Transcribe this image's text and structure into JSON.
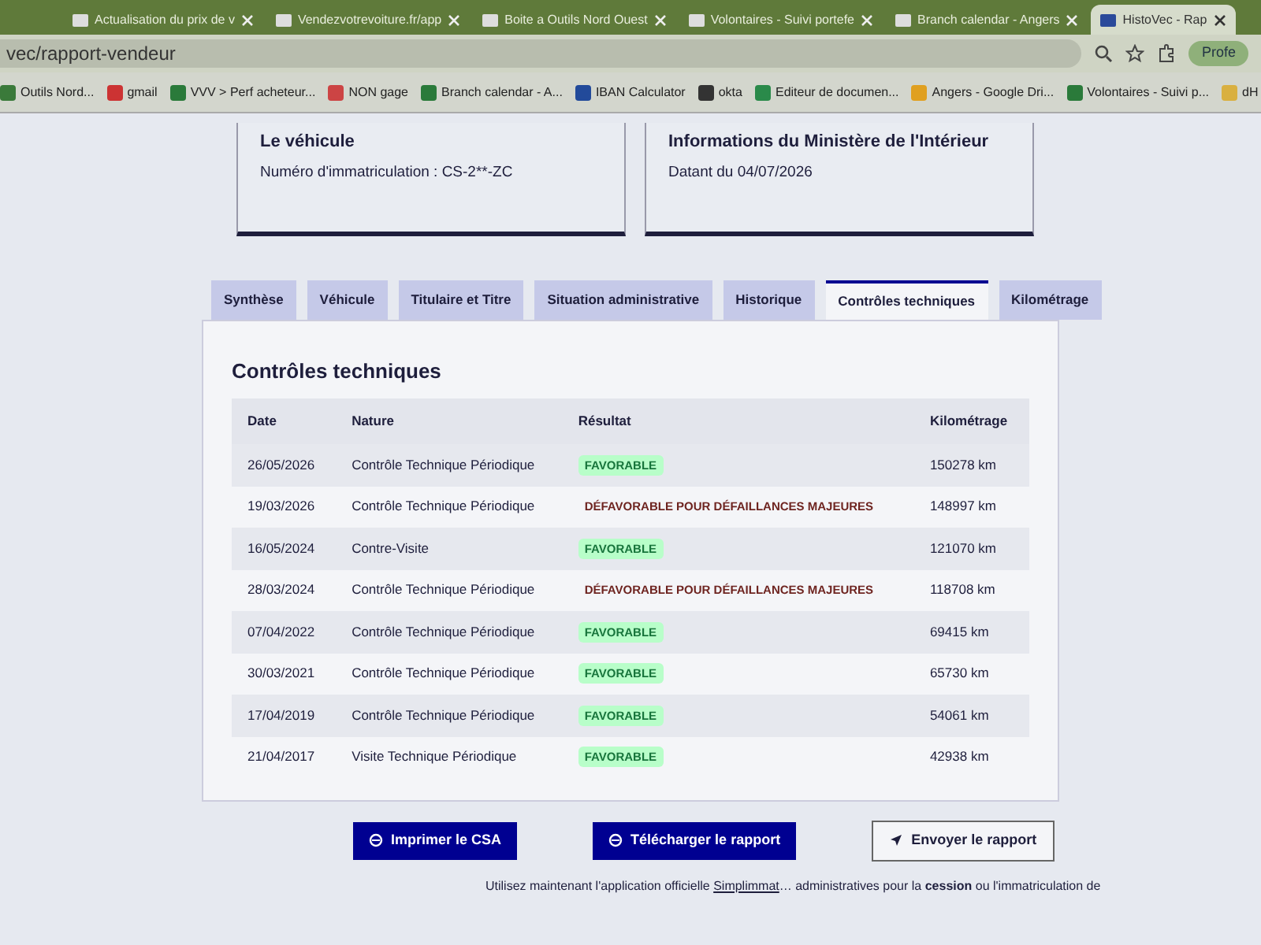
{
  "browser": {
    "tabs": [
      {
        "title": "Actualisation du prix de v",
        "selected": false
      },
      {
        "title": "Vendezvotrevoiture.fr/app",
        "selected": false
      },
      {
        "title": "Boite a Outils Nord Ouest",
        "selected": false
      },
      {
        "title": "Volontaires - Suivi portefe",
        "selected": false
      },
      {
        "title": "Branch calendar - Angers",
        "selected": false
      },
      {
        "title": "HistoVec - Rap",
        "selected": true
      }
    ],
    "address": "vec/rapport-vendeur",
    "profile": "Profe",
    "bookmarks": [
      "Outils Nord...",
      "gmail",
      "VVV > Perf acheteur...",
      "NON gage",
      "Branch calendar - A...",
      "IBAN Calculator",
      "okta",
      "Editeur de documen...",
      "Angers - Google Dri...",
      "Volontaires - Suivi p...",
      "dH"
    ]
  },
  "cards": [
    {
      "title": "Le véhicule",
      "text": "Numéro d'immatriculation : CS-2**-ZC"
    },
    {
      "title": "Informations du Ministère de l'Intérieur",
      "text": "Datant du 04/07/2026"
    }
  ],
  "tabs": [
    {
      "label": "Synthèse",
      "selected": false
    },
    {
      "label": "Véhicule",
      "selected": false
    },
    {
      "label": "Titulaire et Titre",
      "selected": false
    },
    {
      "label": "Situation administrative",
      "selected": false
    },
    {
      "label": "Historique",
      "selected": false
    },
    {
      "label": "Contrôles techniques",
      "selected": true
    },
    {
      "label": "Kilométrage",
      "selected": false
    }
  ],
  "section_title": "Contrôles techniques",
  "table": {
    "columns": [
      "Date",
      "Nature",
      "Résultat",
      "Kilométrage"
    ],
    "rows": [
      {
        "date": "26/05/2026",
        "nature": "Contrôle Technique Périodique",
        "result": "FAVORABLE",
        "kind": "favorable",
        "km": "150278 km"
      },
      {
        "date": "19/03/2026",
        "nature": "Contrôle Technique Périodique",
        "result": "DÉFAVORABLE POUR DÉFAILLANCES MAJEURES",
        "kind": "defavorable",
        "km": "148997 km"
      },
      {
        "date": "16/05/2024",
        "nature": "Contre-Visite",
        "result": "FAVORABLE",
        "kind": "favorable",
        "km": "121070 km"
      },
      {
        "date": "28/03/2024",
        "nature": "Contrôle Technique Périodique",
        "result": "DÉFAVORABLE POUR DÉFAILLANCES MAJEURES",
        "kind": "defavorable",
        "km": "118708 km"
      },
      {
        "date": "07/04/2022",
        "nature": "Contrôle Technique Périodique",
        "result": "FAVORABLE",
        "kind": "favorable",
        "km": "69415 km"
      },
      {
        "date": "30/03/2021",
        "nature": "Contrôle Technique Périodique",
        "result": "FAVORABLE",
        "kind": "favorable",
        "km": "65730 km"
      },
      {
        "date": "17/04/2019",
        "nature": "Contrôle Technique Périodique",
        "result": "FAVORABLE",
        "kind": "favorable",
        "km": "54061 km"
      },
      {
        "date": "21/04/2017",
        "nature": "Visite Technique Périodique",
        "result": "FAVORABLE",
        "kind": "favorable",
        "km": "42938 km"
      }
    ]
  },
  "buttons": [
    {
      "label": "Imprimer le CSA",
      "kind": "primary"
    },
    {
      "label": "Télécharger le rapport",
      "kind": "primary"
    },
    {
      "label": "Envoyer le rapport",
      "kind": "outline"
    }
  ],
  "footer": {
    "before": "Utilisez maintenant l'application officielle ",
    "link": "Simplimmat",
    "after": "… administratives pour la **cession** ou l'immatriculation de"
  }
}
